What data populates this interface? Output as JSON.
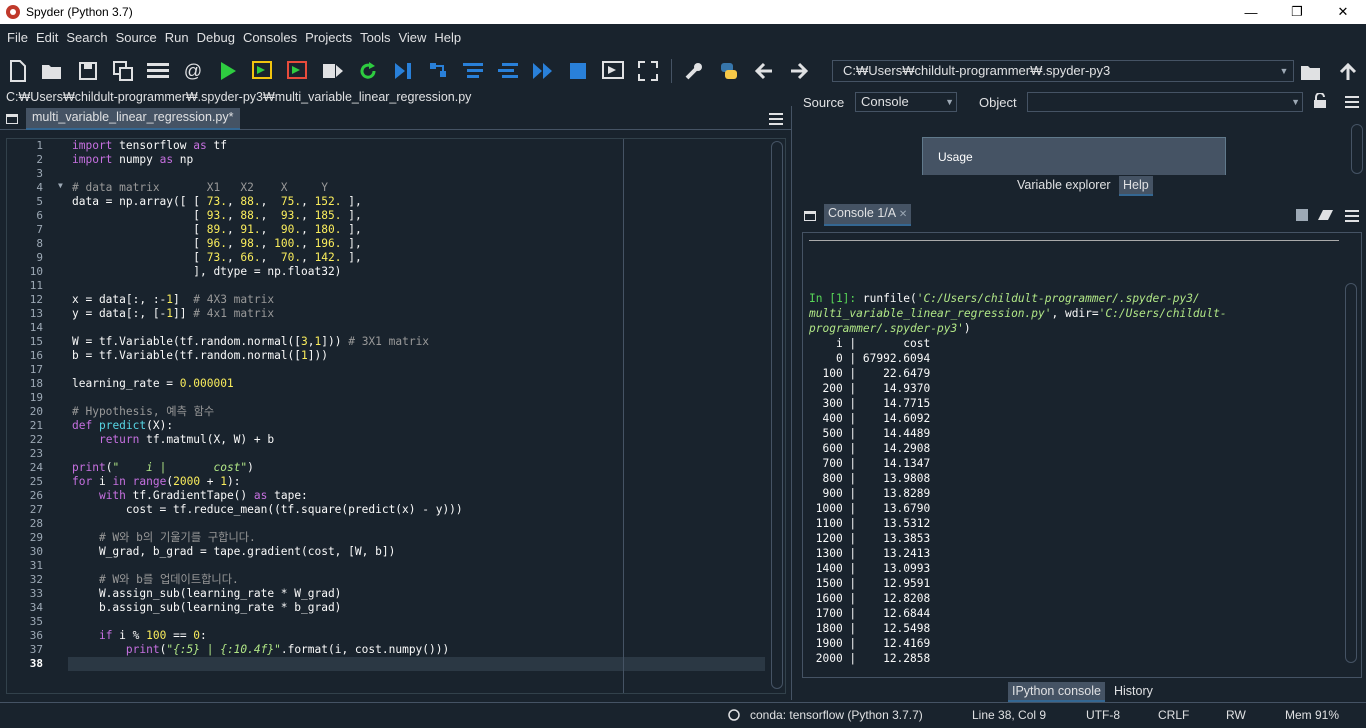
{
  "window": {
    "title": "Spyder (Python 3.7)",
    "min": "—",
    "max": "❐",
    "close": "✕"
  },
  "menu": [
    "File",
    "Edit",
    "Search",
    "Source",
    "Run",
    "Debug",
    "Consoles",
    "Projects",
    "Tools",
    "View",
    "Help"
  ],
  "toolbar": {
    "working_dir": "C:₩Users₩childult-programmer₩.spyder-py3",
    "icons": [
      "new-file-icon",
      "open-folder-icon",
      "save-icon",
      "save-all-icon",
      "outline-icon",
      "at-icon",
      "run-icon",
      "run-cell-icon",
      "run-cell-advance-icon",
      "run-selection-icon",
      "rerun-icon",
      "debug-icon",
      "step-icon",
      "step-into-icon",
      "step-return-icon",
      "continue-icon",
      "stop-icon",
      "maximize-pane-icon",
      "fullscreen-icon",
      "preferences-icon",
      "python-path-icon",
      "back-icon",
      "forward-icon"
    ]
  },
  "editor": {
    "file_path": "C:₩Users₩childult-programmer₩.spyder-py3₩multi_variable_linear_regression.py",
    "tab_label": "multi_variable_linear_regression.py*",
    "current_line": 38,
    "line_count": 38
  },
  "help_pane": {
    "source_label": "Source",
    "source_value": "Console",
    "object_label": "Object",
    "object_value": "",
    "usage_title": "Usage",
    "tabs": [
      "Variable explorer",
      "Help"
    ],
    "active_tab": "Help"
  },
  "console": {
    "tab_label": "Console 1/A",
    "prompt": "In [1]: ",
    "command_1": "runfile(",
    "arg_file_1": "'C:/Users/childult-programmer/.spyder-py3/",
    "arg_file_2": "multi_variable_linear_regression.py'",
    "arg_wdir_label": ", wdir=",
    "arg_wdir_1": "'C:/Users/childult-",
    "arg_wdir_2": "programmer/.spyder-py3'",
    "close_paren": ")",
    "header": "    i |       cost",
    "rows": [
      [
        "0",
        "67992.6094"
      ],
      [
        "100",
        "22.6479"
      ],
      [
        "200",
        "14.9370"
      ],
      [
        "300",
        "14.7715"
      ],
      [
        "400",
        "14.6092"
      ],
      [
        "500",
        "14.4489"
      ],
      [
        "600",
        "14.2908"
      ],
      [
        "700",
        "14.1347"
      ],
      [
        "800",
        "13.9808"
      ],
      [
        "900",
        "13.8289"
      ],
      [
        "1000",
        "13.6790"
      ],
      [
        "1100",
        "13.5312"
      ],
      [
        "1200",
        "13.3853"
      ],
      [
        "1300",
        "13.2413"
      ],
      [
        "1400",
        "13.0993"
      ],
      [
        "1500",
        "12.9591"
      ],
      [
        "1600",
        "12.8208"
      ],
      [
        "1700",
        "12.6844"
      ],
      [
        "1800",
        "12.5498"
      ],
      [
        "1900",
        "12.4169"
      ],
      [
        "2000",
        "12.2858"
      ]
    ],
    "bottom_tabs": [
      "IPython console",
      "History"
    ],
    "active_bottom_tab": "IPython console"
  },
  "status": {
    "conda": "conda: tensorflow (Python 3.7.7)",
    "position": "Line 38, Col 9",
    "encoding": "UTF-8",
    "eol": "CRLF",
    "permissions": "RW",
    "memory": "Mem 91%"
  }
}
